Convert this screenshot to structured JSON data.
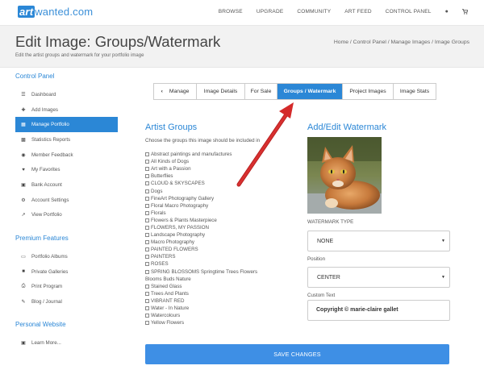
{
  "nav": {
    "logo_art": "art",
    "logo_rest": "wanted.com",
    "links": [
      "BROWSE",
      "UPGRADE",
      "COMMUNITY",
      "ART FEED",
      "CONTROL PANEL"
    ],
    "user_icon": "user-icon",
    "cart_icon": "cart-icon"
  },
  "header": {
    "title": "Edit Image: Groups/Watermark",
    "subtitle": "Edit the artist groups and watermark for your portfolio image",
    "breadcrumbs": "Home / Control Panel / Manage Images / Image Groups"
  },
  "sidebar": {
    "control_panel_label": "Control Panel",
    "control_items": [
      {
        "label": "Dashboard",
        "icon": "list-icon"
      },
      {
        "label": "Add Images",
        "icon": "plus-icon"
      },
      {
        "label": "Manage Portfolio",
        "icon": "image-icon"
      },
      {
        "label": "Statistics Reports",
        "icon": "bar-chart-icon"
      },
      {
        "label": "Member Feedback",
        "icon": "comment-icon"
      },
      {
        "label": "My Favorites",
        "icon": "heart-icon"
      },
      {
        "label": "Bank Account",
        "icon": "bank-icon"
      },
      {
        "label": "Account Settings",
        "icon": "gear-icon"
      },
      {
        "label": "View Portfolio",
        "icon": "external-link-icon"
      }
    ],
    "premium_label": "Premium Features",
    "premium_items": [
      {
        "label": "Portfolio Albums",
        "icon": "folder-icon"
      },
      {
        "label": "Private Galleries",
        "icon": "lock-icon"
      },
      {
        "label": "Print Program",
        "icon": "print-icon"
      },
      {
        "label": "Blog / Journal",
        "icon": "pencil-icon"
      }
    ],
    "personal_label": "Personal Website",
    "personal_items": [
      {
        "label": "Learn More...",
        "icon": "monitor-icon"
      }
    ]
  },
  "tabs": {
    "manage": "Manage",
    "image_details": "Image Details",
    "for_sale": "For Sale",
    "groups_watermark": "Groups / Watermark",
    "project_images": "Project Images",
    "image_stats": "Image Stats"
  },
  "artist_groups": {
    "title": "Artist Groups",
    "description": "Choose the groups this image should be included in",
    "groups": [
      "Abstract paintings and manufactures",
      "All Kinds of Dogs",
      "Art with a Passion",
      "Butterflies",
      "CLOUD & SKYSCAPES",
      "Dogs",
      "FineArt Photography Gallery",
      "Floral Macro Photography",
      "Florals",
      "Flowers & Plants Masterpiece",
      "FLOWERS, MY PASSION",
      "Landscape Photography",
      "Macro Photography",
      "PAINTED FLOWERS",
      "PAINTERS",
      "ROSES",
      "SPRING BLOSSOMS Springtime Trees Flowers"
    ],
    "subgroup_heading": "Blooms Buds Nature",
    "subgroups": [
      "Stained Glass",
      "Trees And Plants",
      "VIBRANT RED",
      "Water - In Nature",
      "Watercolours",
      "Yellow Flowers"
    ]
  },
  "watermark": {
    "title": "Add/Edit Watermark",
    "type_label": "WATERMARK TYPE",
    "type_value": "NONE",
    "position_label": "Position",
    "position_value": "CENTER",
    "custom_text_label": "Custom Text",
    "custom_text_value": "Copyright © marie-claire gallet"
  },
  "save_label": "SAVE CHANGES",
  "colors": {
    "accent": "#2b87d6",
    "save_button": "#3e8fe5",
    "annotation_arrow": "#d42a2a"
  }
}
